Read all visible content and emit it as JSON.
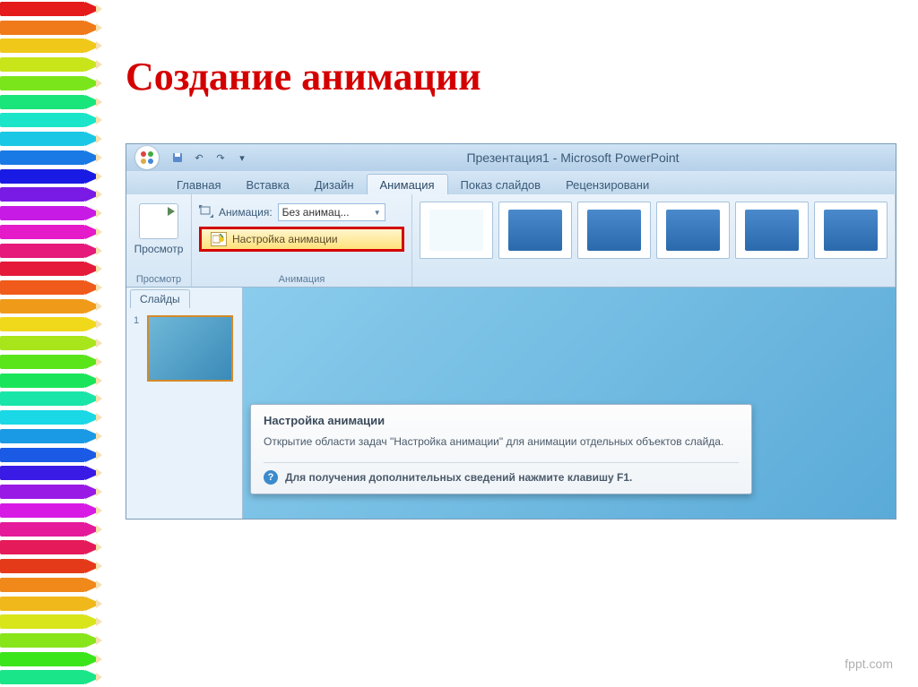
{
  "slide": {
    "title": "Создание анимации"
  },
  "powerpoint": {
    "window_title": "Презентация1 - Microsoft PowerPoint",
    "tabs": [
      "Главная",
      "Вставка",
      "Дизайн",
      "Анимация",
      "Показ слайдов",
      "Рецензировани"
    ],
    "active_tab": 3,
    "ribbon": {
      "preview_label": "Просмотр",
      "preview_group": "Просмотр",
      "animation_group": "Анимация",
      "animation_label": "Анимация:",
      "animation_value": "Без анимац...",
      "custom_animation": "Настройка анимации"
    },
    "slides_pane_tab": "Слайды",
    "slide_number": "1",
    "tooltip": {
      "title": "Настройка анимации",
      "body": "Открытие области задач \"Настройка анимации\" для анимации отдельных объектов слайда.",
      "footer": "Для получения дополнительных сведений нажмите клавишу F1."
    }
  },
  "footer": "fppt.com",
  "pencil_colors": [
    "#e51a1a",
    "#f07a1a",
    "#f0c81a",
    "#c8e51a",
    "#7ae51a",
    "#1ae57a",
    "#1ae5c8",
    "#1ac8e5",
    "#1a7ae5",
    "#1a1ae5",
    "#7a1ae5",
    "#c81ae5",
    "#e51ac8",
    "#e51a7a",
    "#e51a3a",
    "#f05a1a",
    "#f09a1a",
    "#f0d81a",
    "#a8e51a",
    "#5ae51a",
    "#1ae55a",
    "#1ae5a8",
    "#1ad8e5",
    "#1a9ae5",
    "#1a5ae5",
    "#3a1ae5",
    "#9a1ae5",
    "#d81ae5",
    "#e51a9a",
    "#e51a5a",
    "#e53a1a",
    "#f0881a",
    "#f0b81a",
    "#d8e51a",
    "#88e51a",
    "#3ae51a",
    "#1ae588"
  ]
}
